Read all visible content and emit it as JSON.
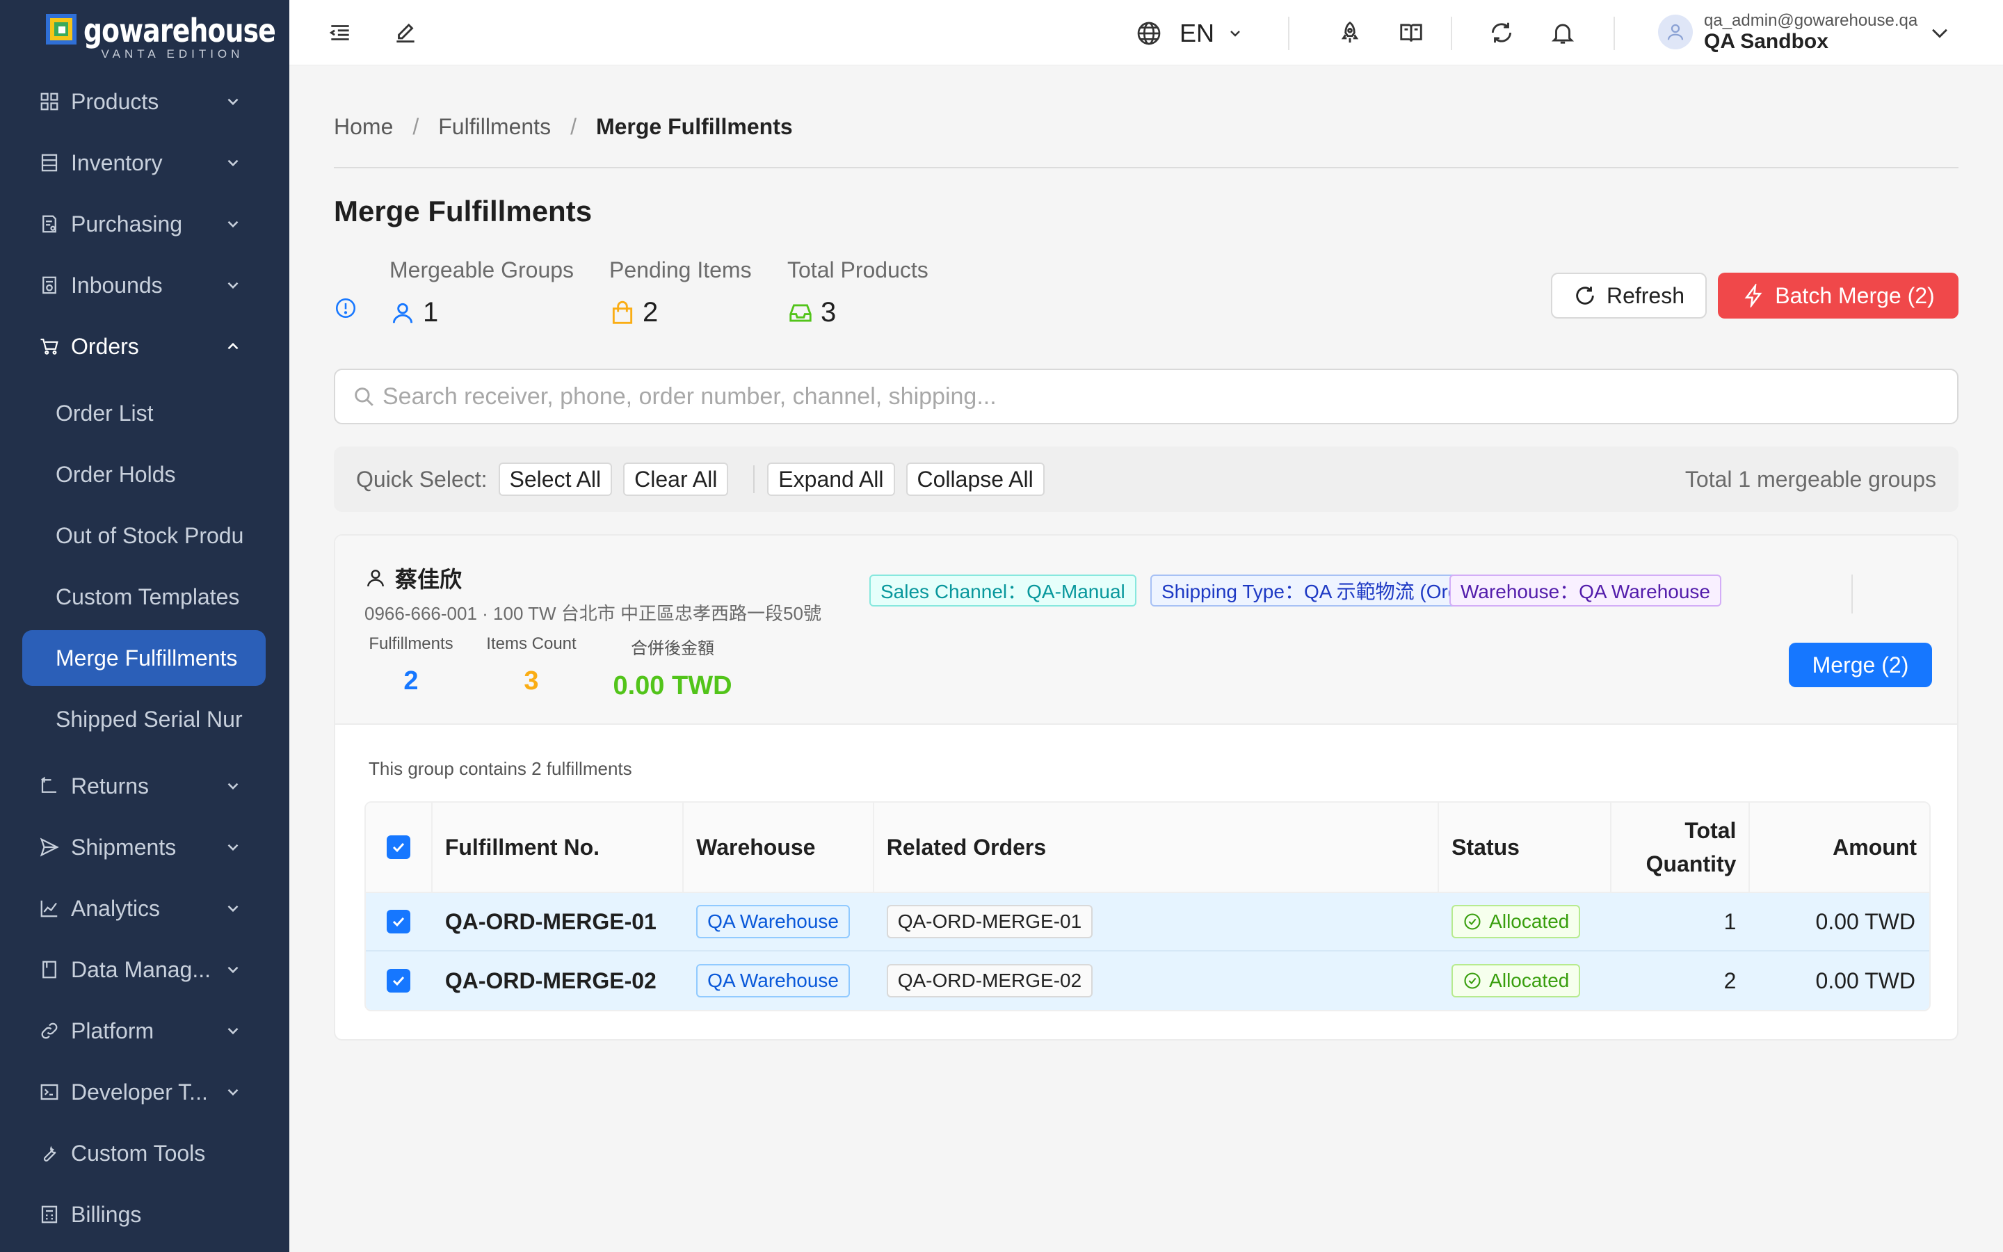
{
  "brand": {
    "name": "gowarehouse",
    "edition": "VANTA EDITION"
  },
  "sidebar": {
    "items": [
      {
        "label": "Products"
      },
      {
        "label": "Inventory"
      },
      {
        "label": "Purchasing"
      },
      {
        "label": "Inbounds"
      },
      {
        "label": "Orders"
      },
      {
        "label": "Returns"
      },
      {
        "label": "Shipments"
      },
      {
        "label": "Analytics"
      },
      {
        "label": "Data Manag..."
      },
      {
        "label": "Platform"
      },
      {
        "label": "Developer T..."
      },
      {
        "label": "Custom Tools"
      },
      {
        "label": "Billings"
      }
    ],
    "orders_sub": [
      {
        "label": "Order List"
      },
      {
        "label": "Order Holds"
      },
      {
        "label": "Out of Stock Produ"
      },
      {
        "label": "Custom Templates"
      },
      {
        "label": "Merge Fulfillments"
      },
      {
        "label": "Shipped Serial Nur"
      }
    ]
  },
  "topbar": {
    "language": "EN",
    "user_email": "qa_admin@gowarehouse.qa",
    "user_org": "QA Sandbox"
  },
  "breadcrumb": [
    "Home",
    "Fulfillments",
    "Merge Fulfillments"
  ],
  "page": {
    "title": "Merge Fulfillments",
    "stats": [
      {
        "label": "Mergeable Groups",
        "value": "1",
        "color": "#1677ff"
      },
      {
        "label": "Pending Items",
        "value": "2",
        "color": "#faad14"
      },
      {
        "label": "Total Products",
        "value": "3",
        "color": "#52c41a"
      }
    ],
    "refresh_label": "Refresh",
    "batch_merge_label": "Batch Merge (2)",
    "search_placeholder": "Search receiver, phone, order number, channel, shipping...",
    "quick": {
      "label": "Quick Select:",
      "select_all": "Select All",
      "clear_all": "Clear All",
      "expand_all": "Expand All",
      "collapse_all": "Collapse All",
      "total": "Total 1 mergeable groups"
    }
  },
  "group": {
    "receiver": "蔡佳欣",
    "address": "0966-666-001 · 100 TW 台北市 中正區忠孝西路一段50號",
    "stats": [
      {
        "label": "Fulfillments",
        "value": "2",
        "color": "#1677ff"
      },
      {
        "label": "Items Count",
        "value": "3",
        "color": "#faad14"
      },
      {
        "label": "合併後金額",
        "value": "0.00 TWD",
        "color": "#52c41a"
      }
    ],
    "tags": {
      "channel": "Sales Channel：QA-Manual",
      "shipping": "Shipping Type：QA 示範物流 (Orders)",
      "warehouse": "Warehouse：QA Warehouse"
    },
    "merge_label": "Merge (2)",
    "note": "This group contains 2 fulfillments",
    "columns": {
      "fulfillment_no": "Fulfillment No.",
      "warehouse": "Warehouse",
      "related_orders": "Related Orders",
      "status": "Status",
      "total_quantity": "Total Quantity",
      "amount": "Amount"
    },
    "rows": [
      {
        "no": "QA-ORD-MERGE-01",
        "warehouse": "QA Warehouse",
        "order": "QA-ORD-MERGE-01",
        "status": "Allocated",
        "qty": "1",
        "amount": "0.00 TWD"
      },
      {
        "no": "QA-ORD-MERGE-02",
        "warehouse": "QA Warehouse",
        "order": "QA-ORD-MERGE-02",
        "status": "Allocated",
        "qty": "2",
        "amount": "0.00 TWD"
      }
    ]
  }
}
